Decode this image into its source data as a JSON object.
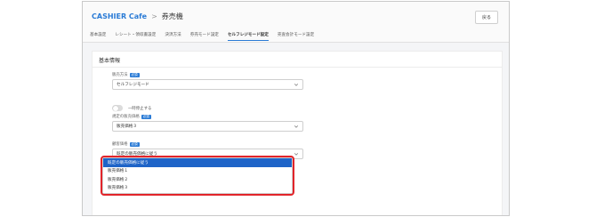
{
  "header": {
    "app_name": "CASHIER Cafe",
    "separator": ">",
    "page_title": "券売機",
    "back_label": "戻る"
  },
  "tabs": [
    {
      "label": "基本設定",
      "active": false
    },
    {
      "label": "レシート・領収書設定",
      "active": false
    },
    {
      "label": "決済方法",
      "active": false
    },
    {
      "label": "券売モード設定",
      "active": false
    },
    {
      "label": "セルフレジモード設定",
      "active": true
    },
    {
      "label": "売査会計モード設定",
      "active": false
    }
  ],
  "panel": {
    "title": "基本情報",
    "required_badge": "必須",
    "sales_method": {
      "label": "販売方法",
      "value": "セルフレジモード"
    },
    "pause_toggle": {
      "label": "一時停止する",
      "on": false
    },
    "default_price": {
      "label": "規定の販売価格",
      "value": "販売価格３"
    },
    "customer_price": {
      "label": "顧客価格",
      "value": "既定の販売価格に従う"
    }
  },
  "dropdown": {
    "options": [
      {
        "label": "既定の販売価格に従う",
        "selected": true
      },
      {
        "label": "販売価格１",
        "selected": false
      },
      {
        "label": "販売価格２",
        "selected": false
      },
      {
        "label": "販売価格３",
        "selected": false
      }
    ]
  },
  "colors": {
    "accent": "#2a7bd6",
    "selected_option": "#1e64c8",
    "highlight_border": "#e2242a"
  }
}
